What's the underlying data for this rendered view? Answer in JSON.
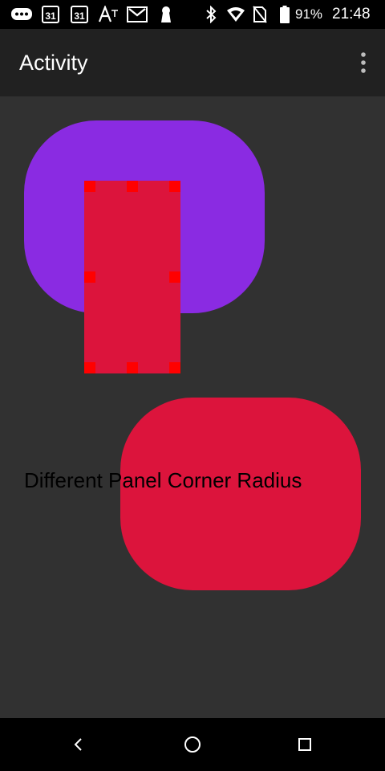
{
  "status_bar": {
    "calendar_1": "31",
    "calendar_2": "31",
    "battery_percent": "91%",
    "time": "21:48",
    "icons": [
      "messages-icon",
      "calendar-icon",
      "calendar-icon",
      "font-icon",
      "gmail-icon",
      "keyhole-icon",
      "bluetooth-icon",
      "wifi-icon",
      "no-sim-icon",
      "battery-icon"
    ]
  },
  "app_bar": {
    "title": "Activity",
    "menu_icon": "more-vert-icon"
  },
  "content": {
    "purple_panel_color": "#8a2be2",
    "red_color": "#dc143c",
    "handle_color": "#ff0000",
    "label": "Different Panel Corner Radius"
  },
  "nav_bar": {
    "icons": [
      "back-icon",
      "home-icon",
      "recents-icon"
    ]
  }
}
